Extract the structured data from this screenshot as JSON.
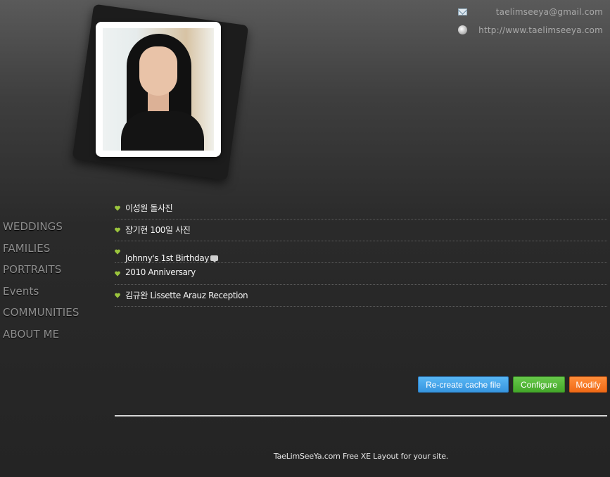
{
  "header": {
    "email": "taelimseeya@gmail.com",
    "website": "http://www.taelimseeya.com",
    "email_icon": "mail-icon",
    "website_icon": "globe-icon"
  },
  "profile": {
    "photo": "portrait-photo"
  },
  "menu": {
    "items": [
      {
        "label": "WEDDINGS"
      },
      {
        "label": "FAMILIES"
      },
      {
        "label": "PORTRAITS"
      },
      {
        "label": "Events"
      },
      {
        "label": "COMMUNITIES"
      },
      {
        "label": "ABOUT ME"
      }
    ]
  },
  "posts": {
    "bullet_icon": "heart-icon",
    "bullet_color": "#9bc53d",
    "items": [
      {
        "title": "이성원 돌사진"
      },
      {
        "title": "장기현 100일 사진"
      },
      {
        "title": "Johnny's 1st Birthday",
        "has_comment": true
      },
      {
        "title": "2010 Anniversary"
      },
      {
        "title": "김규완 Lissette Arauz Reception"
      }
    ]
  },
  "actions": {
    "recreate_cache": "Re-create cache file",
    "configure": "Configure",
    "modify": "Modify",
    "colors": {
      "recreate_cache": "#3796e0",
      "configure": "#44a82a",
      "modify": "#f06a16"
    }
  },
  "footer": {
    "text": "TaeLimSeeYa.com Free XE Layout for your site."
  }
}
